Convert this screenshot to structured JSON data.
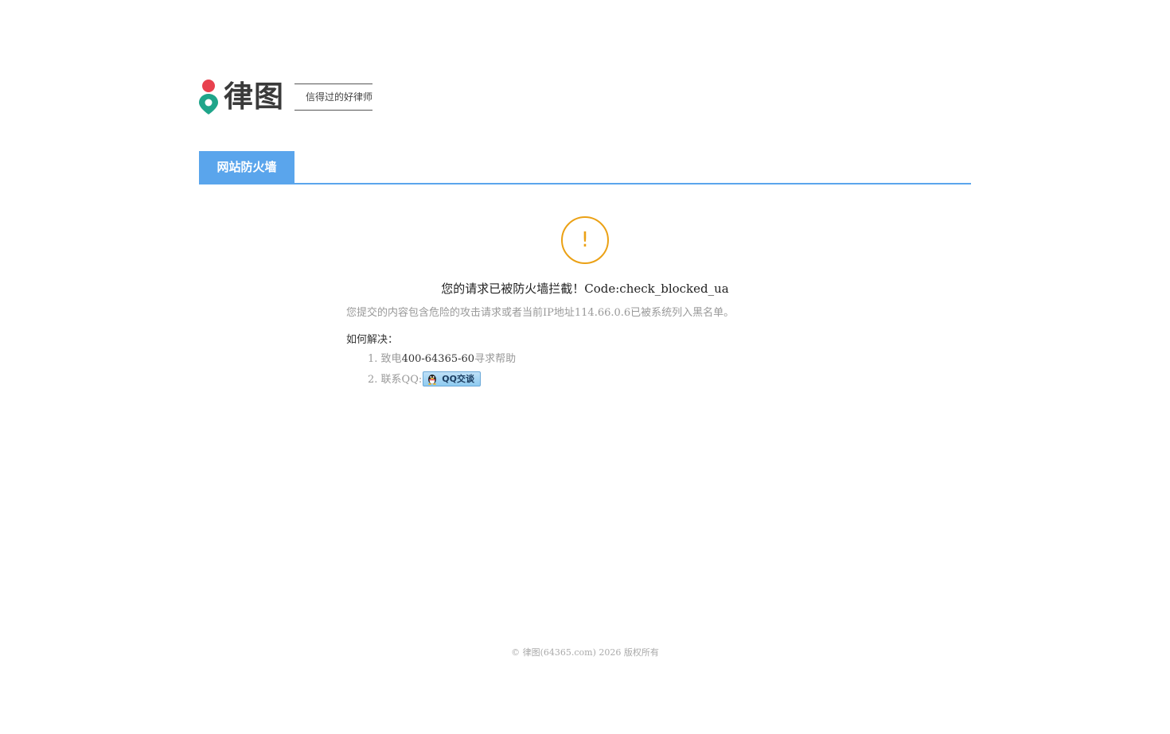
{
  "brand": {
    "name": "律图",
    "slogan": "信得过的好律师",
    "pin_colors": {
      "top": "#e8414e",
      "bottom": "#1fa58a"
    }
  },
  "tab": {
    "label": "网站防火墙",
    "accent": "#5aa5ec"
  },
  "alert": {
    "icon": "warning-icon",
    "symbol": "!",
    "color": "#eba115",
    "headline": "您的请求已被防火墙拦截！Code:check_blocked_ua",
    "reason": "您提交的内容包含危险的攻击请求或者当前IP地址114.66.0.6已被系统列入黑名单。"
  },
  "howto": {
    "title": "如何解决：",
    "steps": [
      {
        "num": "1.",
        "prefix": "致电",
        "phone": "400-64365-60",
        "suffix": "寻求帮助"
      },
      {
        "num": "2.",
        "prefix": "联系QQ:",
        "button_label": "QQ交谈",
        "button_icon": "qq-penguin-icon"
      }
    ]
  },
  "footer": {
    "text": "© 律图(64365.com) 2026 版权所有"
  }
}
